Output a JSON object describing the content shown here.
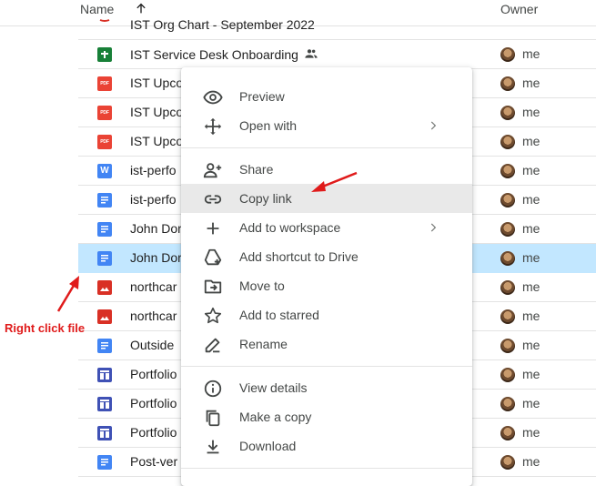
{
  "header": {
    "name_label": "Name",
    "owner_label": "Owner"
  },
  "files": [
    {
      "name": "IST Org Chart - September 2022",
      "type": "partial",
      "owner": "",
      "shared": false,
      "selected": false
    },
    {
      "name": "IST Service Desk Onboarding",
      "type": "sheet",
      "owner": "me",
      "shared": true,
      "selected": false
    },
    {
      "name": "IST Upco",
      "type": "pdf",
      "owner": "me",
      "shared": false,
      "selected": false
    },
    {
      "name": "IST Upco",
      "type": "pdf",
      "owner": "me",
      "shared": false,
      "selected": false
    },
    {
      "name": "IST Upco",
      "type": "pdf",
      "owner": "me",
      "shared": false,
      "selected": false
    },
    {
      "name": "ist-perfo",
      "type": "word",
      "owner": "me",
      "shared": false,
      "selected": false
    },
    {
      "name": "ist-perfo",
      "type": "doc",
      "owner": "me",
      "shared": false,
      "selected": false
    },
    {
      "name": "John Dor",
      "type": "doc",
      "owner": "me",
      "shared": false,
      "selected": false
    },
    {
      "name": "John Dor",
      "type": "doc",
      "owner": "me",
      "shared": false,
      "selected": true
    },
    {
      "name": "northcar",
      "type": "image",
      "owner": "me",
      "shared": false,
      "selected": false
    },
    {
      "name": "northcar",
      "type": "image",
      "owner": "me",
      "shared": false,
      "selected": false
    },
    {
      "name": "Outside",
      "type": "doc",
      "owner": "me",
      "shared": false,
      "selected": false
    },
    {
      "name": "Portfolio",
      "type": "site",
      "owner": "me",
      "shared": false,
      "selected": false
    },
    {
      "name": "Portfolio",
      "type": "site",
      "owner": "me",
      "shared": false,
      "selected": false
    },
    {
      "name": "Portfolio",
      "type": "site",
      "owner": "me",
      "shared": false,
      "selected": false
    },
    {
      "name": "Post-ver",
      "type": "doc",
      "owner": "me",
      "shared": false,
      "selected": false
    }
  ],
  "context_menu": {
    "items": [
      {
        "label": "Preview",
        "icon": "eye-icon",
        "submenu": false
      },
      {
        "label": "Open with",
        "icon": "move-arrows-icon",
        "submenu": true
      },
      {
        "label": "Share",
        "icon": "person-add-icon",
        "submenu": false
      },
      {
        "label": "Copy link",
        "icon": "link-icon",
        "submenu": false,
        "hovered": true
      },
      {
        "label": "Add to workspace",
        "icon": "plus-icon",
        "submenu": true
      },
      {
        "label": "Add shortcut to Drive",
        "icon": "add-shortcut-icon",
        "submenu": false
      },
      {
        "label": "Move to",
        "icon": "folder-move-icon",
        "submenu": false
      },
      {
        "label": "Add to starred",
        "icon": "star-icon",
        "submenu": false
      },
      {
        "label": "Rename",
        "icon": "pencil-icon",
        "submenu": false
      },
      {
        "label": "View details",
        "icon": "info-icon",
        "submenu": false
      },
      {
        "label": "Make a copy",
        "icon": "copy-icon",
        "submenu": false
      },
      {
        "label": "Download",
        "icon": "download-icon",
        "submenu": false
      }
    ]
  },
  "annotation": {
    "text": "Right click file",
    "color": "#e01b1b"
  },
  "colors": {
    "selected_row": "#c2e7ff",
    "menu_hover": "#e9e9e9"
  }
}
